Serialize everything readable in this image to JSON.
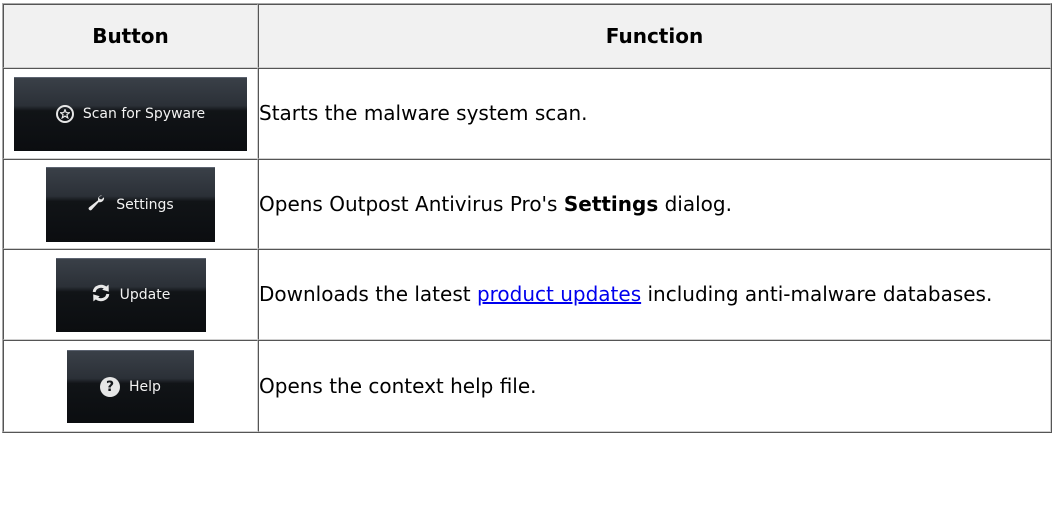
{
  "table": {
    "headers": {
      "button": "Button",
      "function": "Function"
    },
    "rows": [
      {
        "button_label": "Scan for Spyware",
        "icon": "star-circle-icon",
        "text_before": "Starts the malware system scan."
      },
      {
        "button_label": "Settings",
        "icon": "wrench-icon",
        "text_before": "Opens Outpost Antivirus Pro's ",
        "text_bold": "Settings",
        "text_after": " dialog."
      },
      {
        "button_label": "Update",
        "icon": "refresh-icon",
        "text_before": "Downloads the latest ",
        "link_text": "product updates",
        "text_after": " including anti-malware databases."
      },
      {
        "button_label": "Help",
        "icon": "help-icon",
        "icon_glyph": "?",
        "text_before": "Opens the context help file."
      }
    ]
  },
  "colors": {
    "link": "#0000ee",
    "button_bg": "#111417",
    "header_bg": "#f1f1f1"
  }
}
